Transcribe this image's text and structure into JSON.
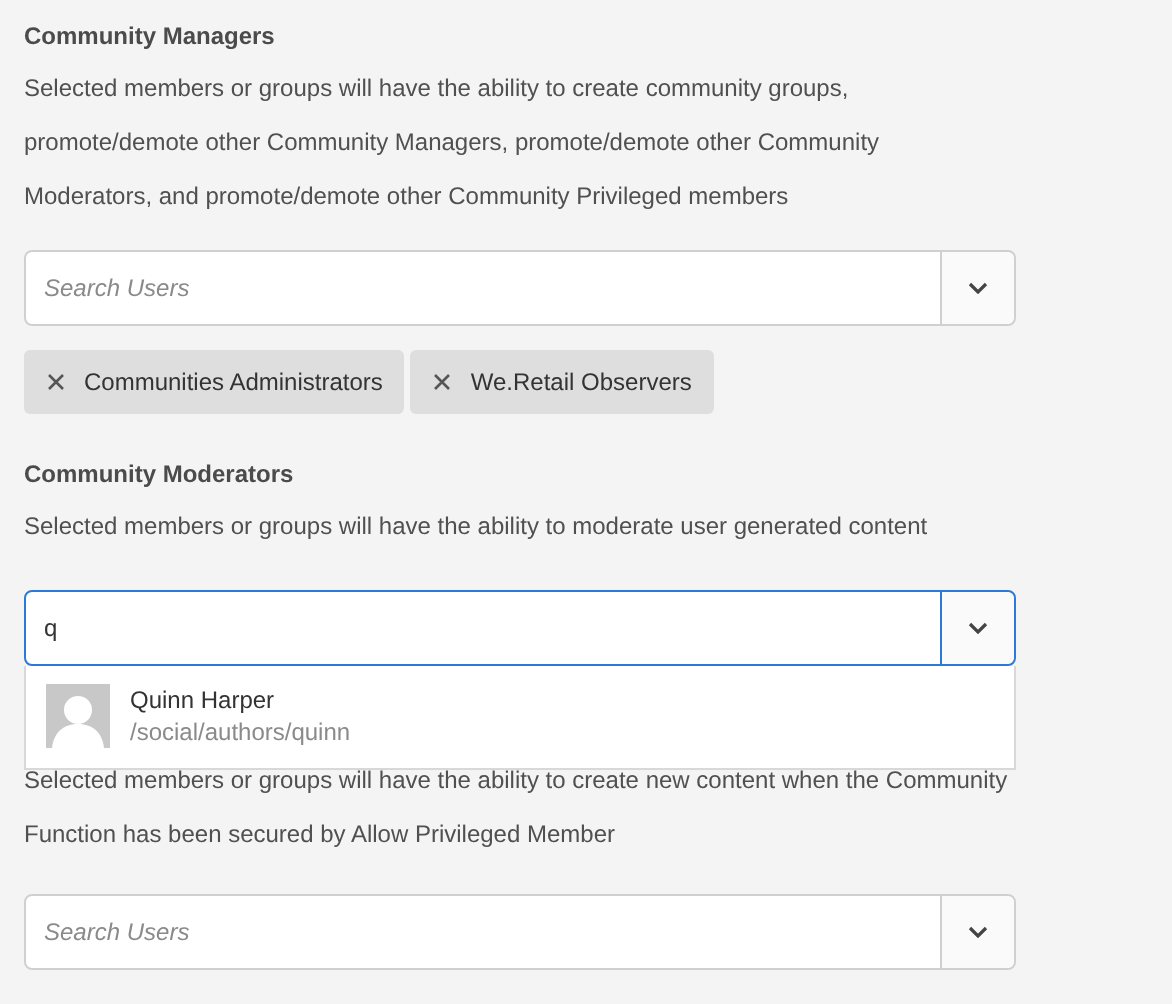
{
  "sections": [
    {
      "title": "Community Managers",
      "description": [
        "Selected members or groups will have the ability to create community groups,",
        "promote/demote other Community Managers, promote/demote other Community",
        "Moderators, and promote/demote other Community Privileged members"
      ],
      "search": {
        "placeholder": "Search Users",
        "focused": false
      },
      "tags": [
        "Communities Administrators",
        "We.Retail Observers"
      ]
    },
    {
      "title": "Community Moderators",
      "description": [
        "Selected members or groups will have the ability to moderate user generated content"
      ],
      "search": {
        "value": "q",
        "focused": true
      },
      "suggestions": [
        {
          "name": "Quinn Harper",
          "path": "/social/authors/quinn"
        }
      ]
    },
    {
      "description": [
        "Selected members or groups will have the ability to create new content when the Community",
        "Function has been secured by Allow Privileged Member"
      ],
      "search": {
        "placeholder": "Search Users",
        "focused": false
      }
    }
  ]
}
